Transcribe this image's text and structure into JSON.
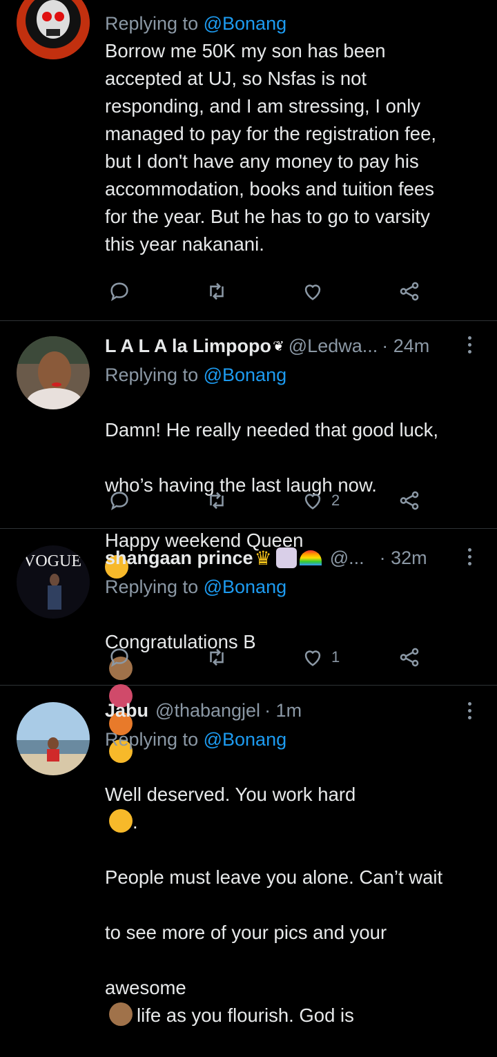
{
  "colors": {
    "background": "#000000",
    "text": "#e7e9ea",
    "muted": "#8b98a5",
    "link": "#1d9bf0",
    "divider": "#2f3336"
  },
  "tweets": [
    {
      "reply_prefix": "Replying to",
      "reply_to": "@Bonang",
      "text": "Borrow me 50K my son has been\naccepted at UJ, so Nsfas is not\nresponding, and I am stressing, I only\nmanaged to pay for the registration fee,\nbut I don't have any money to pay his\naccommodation, books and tuition fees\nfor the year. But he has to go to varsity\nthis year nakanani.",
      "likes": ""
    },
    {
      "name": "L A L A la Limpopo",
      "handle": "@Ledwa...",
      "time": "· 24m",
      "reply_prefix": "Replying to",
      "reply_to": "@Bonang",
      "text_lines": [
        "Damn! He really needed that good luck,",
        "who’s having the last laugh now.",
        "Happy weekend Queen"
      ],
      "likes": "2"
    },
    {
      "name": "shangaan prince",
      "handle": "@...",
      "time": "· 32m",
      "reply_prefix": "Replying to",
      "reply_to": "@Bonang",
      "text": "Congratulations B",
      "likes": "1"
    },
    {
      "name": "Jabu",
      "handle": "@thabangjel",
      "time": "· 1m",
      "reply_prefix": "Replying to",
      "reply_to": "@Bonang",
      "text_line1": "Well deserved. You work hard",
      "text_line1_end": ".",
      "text_line2": "People must leave you alone. Can’t wait",
      "text_line3": "to see more of your pics and your",
      "text_line4a": "awesome",
      "text_line4b": "life as you flourish. God is"
    }
  ],
  "icons": [
    "reply-icon",
    "retweet-icon",
    "like-icon",
    "share-icon",
    "more-icon"
  ]
}
